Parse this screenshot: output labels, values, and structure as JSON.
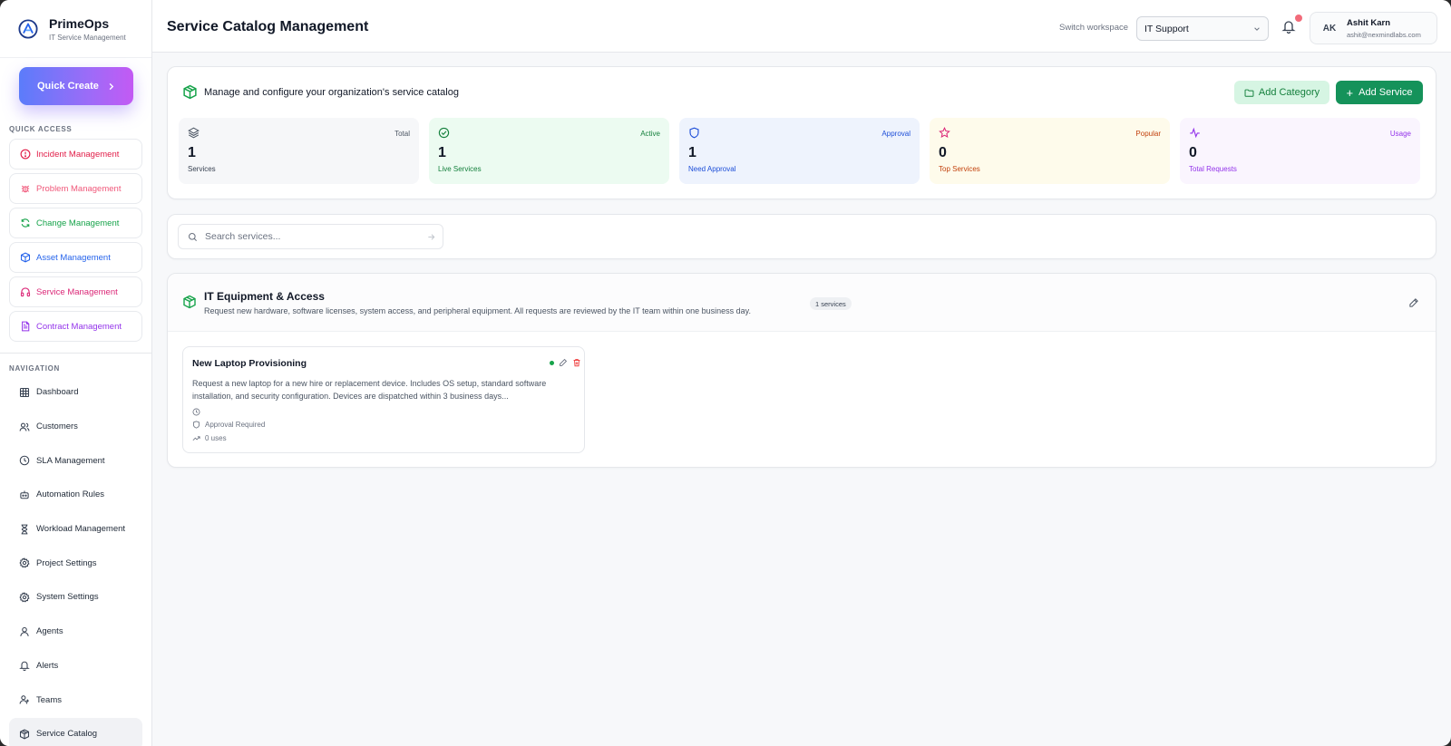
{
  "brand": {
    "name": "PrimeOps",
    "subtitle": "IT Service Management"
  },
  "quick_create": {
    "label": "Quick Create"
  },
  "quick_access": {
    "title": "QUICK ACCESS",
    "items": [
      {
        "label": "Incident Management",
        "color": "#e11d48",
        "icon": "alert-circle-icon"
      },
      {
        "label": "Problem Management",
        "color": "#f0587a",
        "icon": "bug-icon"
      },
      {
        "label": "Change Management",
        "color": "#16a34a",
        "icon": "refresh-icon"
      },
      {
        "label": "Asset Management",
        "color": "#2563eb",
        "icon": "box-icon"
      },
      {
        "label": "Service Management",
        "color": "#db2777",
        "icon": "headphones-icon"
      },
      {
        "label": "Contract Management",
        "color": "#9333ea",
        "icon": "document-icon"
      }
    ]
  },
  "navigation": {
    "title": "NAVIGATION",
    "items": [
      {
        "label": "Dashboard",
        "icon": "grid-icon"
      },
      {
        "label": "Customers",
        "icon": "users-icon"
      },
      {
        "label": "SLA Management",
        "icon": "clock-icon"
      },
      {
        "label": "Automation Rules",
        "icon": "robot-icon"
      },
      {
        "label": "Workload Management",
        "icon": "hourglass-icon"
      },
      {
        "label": "Project Settings",
        "icon": "gear-icon"
      },
      {
        "label": "System Settings",
        "icon": "gear-icon"
      },
      {
        "label": "Agents",
        "icon": "user-icon"
      },
      {
        "label": "Alerts",
        "icon": "bell-icon"
      },
      {
        "label": "Teams",
        "icon": "team-icon"
      },
      {
        "label": "Service Catalog",
        "icon": "package-icon",
        "active": true
      }
    ]
  },
  "header": {
    "title": "Service Catalog Management",
    "workspace_label": "Switch workspace",
    "workspace_value": "IT Support",
    "user": {
      "initials": "AK",
      "name": "Ashit Karn",
      "email": "ashit@nexmindlabs.com"
    },
    "notification_dot_color": "#f26b7a"
  },
  "summary": {
    "description": "Manage and configure your organization's service catalog",
    "add_category_label": "Add Category",
    "add_service_label": "Add Service",
    "stats": [
      {
        "tag": "Total",
        "value": "1",
        "label": "Services",
        "bg": "#f6f7f9",
        "accent": "#4b5563",
        "icon": "layers-icon"
      },
      {
        "tag": "Active",
        "value": "1",
        "label": "Live Services",
        "bg": "#ecfbf1",
        "accent": "#15803d",
        "icon": "check-circle-icon"
      },
      {
        "tag": "Approval",
        "value": "1",
        "label": "Need Approval",
        "bg": "#eef3fd",
        "accent": "#1d4ed8",
        "icon": "shield-icon"
      },
      {
        "tag": "Popular",
        "value": "0",
        "label": "Top Services",
        "bg": "#fefbeb",
        "accent": "#c2410c",
        "icon": "star-icon"
      },
      {
        "tag": "Usage",
        "value": "0",
        "label": "Total Requests",
        "bg": "#faf5fe",
        "accent": "#9333ea",
        "icon": "activity-icon"
      }
    ]
  },
  "search": {
    "placeholder": "Search services..."
  },
  "category": {
    "title": "IT Equipment & Access",
    "description": "Request new hardware, software licenses, system access, and peripheral equipment. All requests are reviewed by the IT team within one business day.",
    "badge": "1 services",
    "services": [
      {
        "title": "New Laptop Provisioning",
        "description": "Request a new laptop for a new hire or replacement device. Includes OS setup, standard software installation, and security configuration. Devices are dispatched within 3 business days...",
        "approval": "Approval Required",
        "uses": "0 uses",
        "status_color": "#16a34a"
      }
    ]
  }
}
